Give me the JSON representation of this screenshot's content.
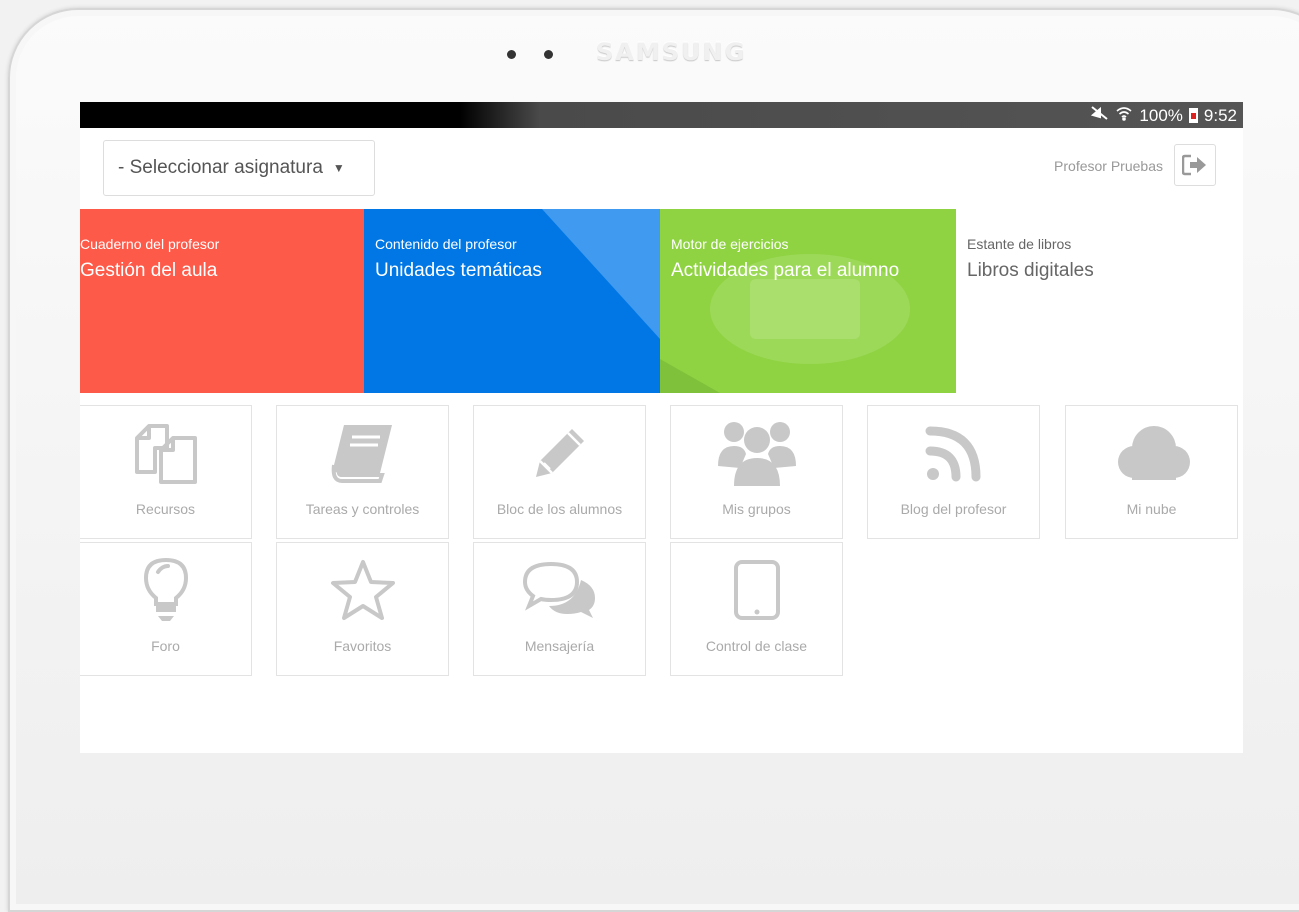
{
  "device": {
    "brand": "SAMSUNG"
  },
  "statusbar": {
    "battery": "100%",
    "time": "9:52"
  },
  "header": {
    "subject_select": "- Seleccionar asignatura",
    "user_name": "Profesor Pruebas"
  },
  "tiles": [
    {
      "sub": "Cuaderno del profesor",
      "title": "Gestión del aula",
      "color": "#fe5a4a"
    },
    {
      "sub": "Contenido del profesor",
      "title": "Unidades temáticas",
      "color": "#0077e4"
    },
    {
      "sub": "Motor de ejercicios",
      "title": "Actividades para el alumno",
      "color": "#8fd343"
    },
    {
      "sub": "Estante de libros",
      "title": "Libros digitales",
      "color": "#ffffff"
    }
  ],
  "grid": [
    {
      "label": "Recursos",
      "icon": "copy-icon"
    },
    {
      "label": "Tareas y controles",
      "icon": "book-icon"
    },
    {
      "label": "Bloc de los alumnos",
      "icon": "pencil-icon"
    },
    {
      "label": "Mis grupos",
      "icon": "group-icon"
    },
    {
      "label": "Blog del profesor",
      "icon": "rss-icon"
    },
    {
      "label": "Mi nube",
      "icon": "cloud-icon"
    },
    {
      "label": "Foro",
      "icon": "lightbulb-icon"
    },
    {
      "label": "Favoritos",
      "icon": "star-icon"
    },
    {
      "label": "Mensajería",
      "icon": "chat-icon"
    },
    {
      "label": "Control de clase",
      "icon": "tablet-icon"
    }
  ]
}
